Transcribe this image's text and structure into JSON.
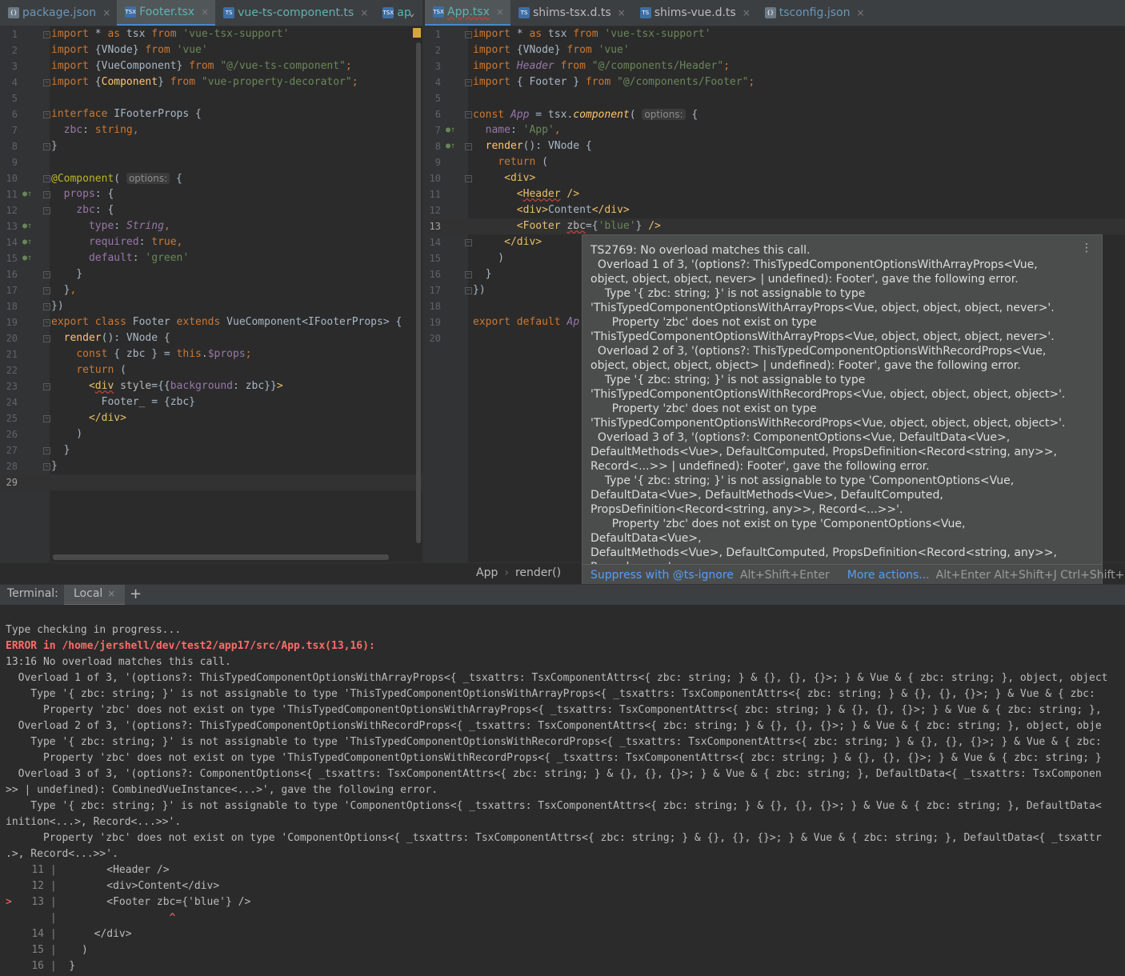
{
  "tabs_left": [
    {
      "label": "package.json",
      "icon": "json",
      "style": "blue"
    },
    {
      "label": "Footer.tsx",
      "icon": "tsx",
      "style": "teal",
      "active": true
    },
    {
      "label": "vue-ts-component.ts",
      "icon": "ts",
      "style": "teal"
    },
    {
      "label": "ap",
      "icon": "tsx",
      "style": "teal"
    }
  ],
  "tabs_right": [
    {
      "label": "App.tsx",
      "icon": "tsx",
      "style": "teal",
      "active": true,
      "error": true
    },
    {
      "label": "shims-tsx.d.ts",
      "icon": "ts",
      "style": "plain"
    },
    {
      "label": "shims-vue.d.ts",
      "icon": "ts",
      "style": "plain"
    },
    {
      "label": "tsconfig.json",
      "icon": "json",
      "style": "blue"
    }
  ],
  "left_editor": {
    "line_numbers": [
      "1",
      "2",
      "3",
      "4",
      "5",
      "6",
      "7",
      "8",
      "9",
      "10",
      "11",
      "12",
      "13",
      "14",
      "15",
      "16",
      "17",
      "18",
      "19",
      "20",
      "21",
      "22",
      "23",
      "24",
      "25",
      "26",
      "27",
      "28",
      "29"
    ],
    "current_line": "29"
  },
  "right_editor": {
    "line_numbers": [
      "1",
      "2",
      "3",
      "4",
      "5",
      "6",
      "7",
      "8",
      "9",
      "10",
      "11",
      "12",
      "13",
      "14",
      "15",
      "16",
      "17",
      "18",
      "19",
      "20"
    ],
    "current_line": "13",
    "options_hint": "options:"
  },
  "breadcrumb": {
    "file": "App",
    "method": "render()"
  },
  "popup": {
    "text": "TS2769: No overload matches this call.\n  Overload 1 of 3, '(options?: ThisTypedComponentOptionsWithArrayProps<Vue,\nobject, object, object, never> | undefined): Footer', gave the following error.\n    Type '{ zbc: string; }' is not assignable to type\n'ThisTypedComponentOptionsWithArrayProps<Vue, object, object, object, never>'.\n      Property 'zbc' does not exist on type\n'ThisTypedComponentOptionsWithArrayProps<Vue, object, object, object, never>'.\n  Overload 2 of 3, '(options?: ThisTypedComponentOptionsWithRecordProps<Vue,\nobject, object, object, object> | undefined): Footer', gave the following error.\n    Type '{ zbc: string; }' is not assignable to type\n'ThisTypedComponentOptionsWithRecordProps<Vue, object, object, object, object>'.\n      Property 'zbc' does not exist on type\n'ThisTypedComponentOptionsWithRecordProps<Vue, object, object, object, object>'.\n  Overload 3 of 3, '(options?: ComponentOptions<Vue, DefaultData<Vue>,\nDefaultMethods<Vue>, DefaultComputed, PropsDefinition<Record<string, any>>,\nRecord<...>> | undefined): Footer', gave the following error.\n    Type '{ zbc: string; }' is not assignable to type 'ComponentOptions<Vue,\nDefaultData<Vue>, DefaultMethods<Vue>, DefaultComputed,\nPropsDefinition<Record<string, any>>, Record<...>>'.\n      Property 'zbc' does not exist on type 'ComponentOptions<Vue, DefaultData<Vue>,\nDefaultMethods<Vue>, DefaultComputed, PropsDefinition<Record<string, any>>,\nRecord<...>>'.",
    "suppress_label": "Suppress with @ts-ignore",
    "suppress_key": "Alt+Shift+Enter",
    "more_label": "More actions...",
    "more_key": "Alt+Enter Alt+Shift+J Ctrl+Shift+M"
  },
  "terminal": {
    "title": "Terminal:",
    "tab_label": "Local",
    "lines": [
      "Type checking in progress...",
      "ERROR in /home/jershell/dev/test2/app17/src/App.tsx(13,16):",
      "13:16 No overload matches this call.",
      "  Overload 1 of 3, '(options?: ThisTypedComponentOptionsWithArrayProps<{ _tsxattrs: TsxComponentAttrs<{ zbc: string; } & {}, {}, {}>; } & Vue & { zbc: string; }, object, object",
      "    Type '{ zbc: string; }' is not assignable to type 'ThisTypedComponentOptionsWithArrayProps<{ _tsxattrs: TsxComponentAttrs<{ zbc: string; } & {}, {}, {}>; } & Vue & { zbc:",
      "      Property 'zbc' does not exist on type 'ThisTypedComponentOptionsWithArrayProps<{ _tsxattrs: TsxComponentAttrs<{ zbc: string; } & {}, {}, {}>; } & Vue & { zbc: string; },",
      "  Overload 2 of 3, '(options?: ThisTypedComponentOptionsWithRecordProps<{ _tsxattrs: TsxComponentAttrs<{ zbc: string; } & {}, {}, {}>; } & Vue & { zbc: string; }, object, obje",
      "    Type '{ zbc: string; }' is not assignable to type 'ThisTypedComponentOptionsWithRecordProps<{ _tsxattrs: TsxComponentAttrs<{ zbc: string; } & {}, {}, {}>; } & Vue & { zbc:",
      "      Property 'zbc' does not exist on type 'ThisTypedComponentOptionsWithRecordProps<{ _tsxattrs: TsxComponentAttrs<{ zbc: string; } & {}, {}, {}>; } & Vue & { zbc: string; }",
      "  Overload 3 of 3, '(options?: ComponentOptions<{ _tsxattrs: TsxComponentAttrs<{ zbc: string; } & {}, {}, {}>; } & Vue & { zbc: string; }, DefaultData<{ _tsxattrs: TsxComponen",
      ">> | undefined): CombinedVueInstance<...>', gave the following error.",
      "    Type '{ zbc: string; }' is not assignable to type 'ComponentOptions<{ _tsxattrs: TsxComponentAttrs<{ zbc: string; } & {}, {}, {}>; } & Vue & { zbc: string; }, DefaultData<",
      "inition<...>, Record<...>>'.",
      "      Property 'zbc' does not exist on type 'ComponentOptions<{ _tsxattrs: TsxComponentAttrs<{ zbc: string; } & {}, {}, {}>; } & Vue & { zbc: string; }, DefaultData<{ _tsxattr",
      ".>, Record<...>>'."
    ],
    "snippet": [
      {
        "marker": "",
        "num": "11",
        "code": "        <Header />"
      },
      {
        "marker": "",
        "num": "12",
        "code": "        <div>Content</div>"
      },
      {
        "marker": ">",
        "num": "13",
        "code": "        <Footer zbc={'blue'} />"
      },
      {
        "marker": "",
        "num": "",
        "code": "                  ^"
      },
      {
        "marker": "",
        "num": "14",
        "code": "      </div>"
      },
      {
        "marker": "",
        "num": "15",
        "code": "    )"
      },
      {
        "marker": "",
        "num": "16",
        "code": "  }"
      }
    ]
  },
  "colors": {
    "accent": "#4a88c7",
    "error": "#ff6b68",
    "link": "#589df6"
  }
}
